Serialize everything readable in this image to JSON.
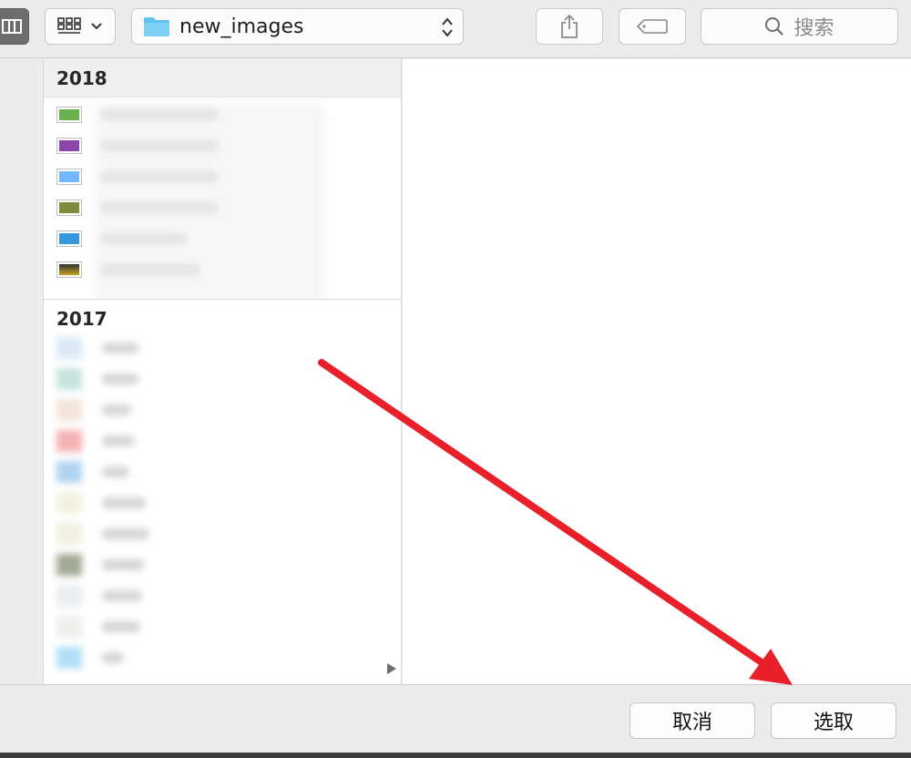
{
  "toolbar": {
    "path_label": "new_images",
    "search_placeholder": "搜索",
    "view_icon": "column-view-icon",
    "grid_icon": "grid-icon",
    "folder_icon": "folder-icon",
    "share_icon": "share-icon",
    "tag_icon": "tag-icon",
    "search_icon": "search-icon"
  },
  "sections": [
    {
      "year": "2018"
    },
    {
      "year": "2017"
    }
  ],
  "files_2018": [
    {
      "thumb_color": "#6ab04c"
    },
    {
      "thumb_color": "#8e44ad"
    },
    {
      "thumb_color": "#74b9ff"
    },
    {
      "thumb_color": "#7f8c3d"
    },
    {
      "thumb_color": "#3498db"
    },
    {
      "thumb_color": "#c9a227"
    }
  ],
  "files_2017": [
    {
      "thumb_color": "#d6e6f5"
    },
    {
      "thumb_color": "#bfe0d9"
    },
    {
      "thumb_color": "#f3e1d6"
    },
    {
      "thumb_color": "#f5a9a9"
    },
    {
      "thumb_color": "#a9cfee"
    },
    {
      "thumb_color": "#f1f0dc"
    },
    {
      "thumb_color": "#efeedd"
    },
    {
      "thumb_color": "#9aa08a"
    },
    {
      "thumb_color": "#e6ecef"
    },
    {
      "thumb_color": "#ececea"
    },
    {
      "thumb_color": "#a8dcf5"
    }
  ],
  "footer": {
    "cancel_label": "取消",
    "choose_label": "选取"
  },
  "annotation": {
    "arrow_color": "#e8202a"
  }
}
